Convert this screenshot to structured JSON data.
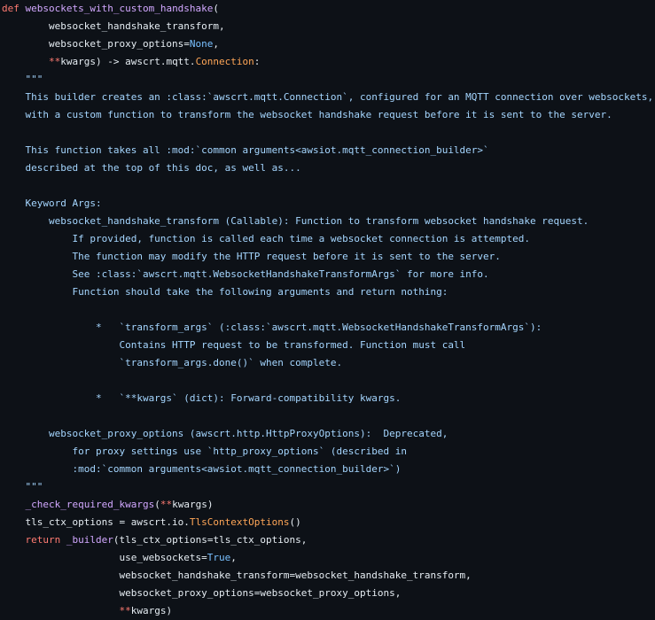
{
  "editor": {
    "colors": {
      "background": "#0d1117",
      "keyword": "#ff7b72",
      "function": "#d2a8ff",
      "string": "#a5d6ff",
      "class": "#ffa657",
      "constant": "#79c0ff",
      "plain": "#e6edf3"
    },
    "lines": [
      [
        [
          "kw",
          "def"
        ],
        [
          "pl",
          " "
        ],
        [
          "fn",
          "websockets_with_custom_handshake"
        ],
        [
          "pl",
          "("
        ]
      ],
      [
        [
          "pl",
          "        websocket_handshake_transform,"
        ]
      ],
      [
        [
          "pl",
          "        websocket_proxy_options="
        ],
        [
          "con",
          "None"
        ],
        [
          "pl",
          ","
        ]
      ],
      [
        [
          "pl",
          "        "
        ],
        [
          "kw",
          "**"
        ],
        [
          "pl",
          "kwargs) -> awscrt.mqtt."
        ],
        [
          "cls",
          "Connection"
        ],
        [
          "pl",
          ":"
        ]
      ],
      [
        [
          "str",
          "    \"\"\""
        ]
      ],
      [
        [
          "str",
          "    This builder creates an :class:`awscrt.mqtt.Connection`, configured for an MQTT connection over websockets,"
        ]
      ],
      [
        [
          "str",
          "    with a custom function to transform the websocket handshake request before it is sent to the server."
        ]
      ],
      [
        [
          "str",
          ""
        ]
      ],
      [
        [
          "str",
          "    This function takes all :mod:`common arguments<awsiot.mqtt_connection_builder>`"
        ]
      ],
      [
        [
          "str",
          "    described at the top of this doc, as well as..."
        ]
      ],
      [
        [
          "str",
          ""
        ]
      ],
      [
        [
          "str",
          "    Keyword Args:"
        ]
      ],
      [
        [
          "str",
          "        websocket_handshake_transform (Callable): Function to transform websocket handshake request."
        ]
      ],
      [
        [
          "str",
          "            If provided, function is called each time a websocket connection is attempted."
        ]
      ],
      [
        [
          "str",
          "            The function may modify the HTTP request before it is sent to the server."
        ]
      ],
      [
        [
          "str",
          "            See :class:`awscrt.mqtt.WebsocketHandshakeTransformArgs` for more info."
        ]
      ],
      [
        [
          "str",
          "            Function should take the following arguments and return nothing:"
        ]
      ],
      [
        [
          "str",
          ""
        ]
      ],
      [
        [
          "str",
          "                *   `transform_args` (:class:`awscrt.mqtt.WebsocketHandshakeTransformArgs`):"
        ]
      ],
      [
        [
          "str",
          "                    Contains HTTP request to be transformed. Function must call"
        ]
      ],
      [
        [
          "str",
          "                    `transform_args.done()` when complete."
        ]
      ],
      [
        [
          "str",
          ""
        ]
      ],
      [
        [
          "str",
          "                *   `**kwargs` (dict): Forward-compatibility kwargs."
        ]
      ],
      [
        [
          "str",
          ""
        ]
      ],
      [
        [
          "str",
          "        websocket_proxy_options (awscrt.http.HttpProxyOptions):  Deprecated,"
        ]
      ],
      [
        [
          "str",
          "            for proxy settings use `http_proxy_options` (described in"
        ]
      ],
      [
        [
          "str",
          "            :mod:`common arguments<awsiot.mqtt_connection_builder>`)"
        ]
      ],
      [
        [
          "str",
          "    \"\"\""
        ]
      ],
      [
        [
          "pl",
          "    "
        ],
        [
          "fn",
          "_check_required_kwargs"
        ],
        [
          "pl",
          "("
        ],
        [
          "kw",
          "**"
        ],
        [
          "pl",
          "kwargs)"
        ]
      ],
      [
        [
          "pl",
          "    tls_ctx_options = awscrt.io."
        ],
        [
          "cls",
          "TlsContextOptions"
        ],
        [
          "pl",
          "()"
        ]
      ],
      [
        [
          "pl",
          "    "
        ],
        [
          "kw",
          "return"
        ],
        [
          "pl",
          " "
        ],
        [
          "fn",
          "_builder"
        ],
        [
          "pl",
          "(tls_ctx_options=tls_ctx_options,"
        ]
      ],
      [
        [
          "pl",
          "                    use_websockets="
        ],
        [
          "con",
          "True"
        ],
        [
          "pl",
          ","
        ]
      ],
      [
        [
          "pl",
          "                    websocket_handshake_transform=websocket_handshake_transform,"
        ]
      ],
      [
        [
          "pl",
          "                    websocket_proxy_options=websocket_proxy_options,"
        ]
      ],
      [
        [
          "pl",
          "                    "
        ],
        [
          "kw",
          "**"
        ],
        [
          "pl",
          "kwargs)"
        ]
      ]
    ]
  }
}
